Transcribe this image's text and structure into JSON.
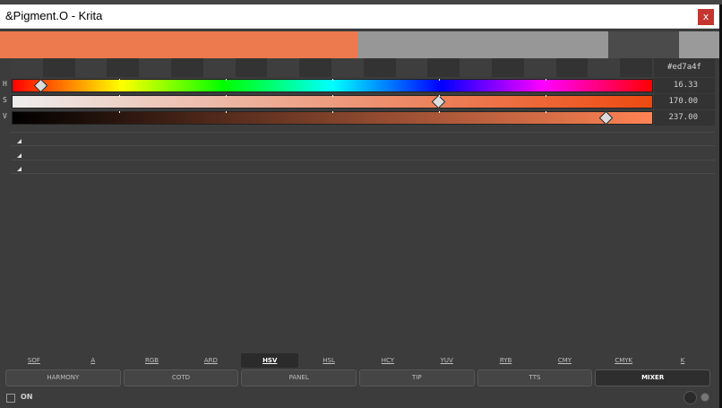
{
  "window": {
    "title": "&Pigment.O - Krita",
    "close_label": "x"
  },
  "swatches": [
    {
      "name": "current",
      "color": "#ed7a4f"
    },
    {
      "name": "previous",
      "color": "#979797"
    },
    {
      "name": "foreground",
      "color": "#4b4b4b"
    },
    {
      "name": "background",
      "color": "#9a9a9a"
    }
  ],
  "hex_value": "#ed7a4f",
  "sliders": [
    {
      "label": "H",
      "value": "16.33",
      "fraction": 0.045
    },
    {
      "label": "S",
      "value": "170.00",
      "fraction": 0.667
    },
    {
      "label": "V",
      "value": "237.00",
      "fraction": 0.929
    }
  ],
  "modes": [
    {
      "label": "SOF",
      "active": false
    },
    {
      "label": "A",
      "active": false
    },
    {
      "label": "RGB",
      "active": false
    },
    {
      "label": "ARD",
      "active": false
    },
    {
      "label": "HSV",
      "active": true
    },
    {
      "label": "HSL",
      "active": false
    },
    {
      "label": "HCY",
      "active": false
    },
    {
      "label": "YUV",
      "active": false
    },
    {
      "label": "RYB",
      "active": false
    },
    {
      "label": "CMY",
      "active": false
    },
    {
      "label": "CMYK",
      "active": false
    },
    {
      "label": "K",
      "active": false
    }
  ],
  "panels": [
    {
      "label": "HARMONY",
      "active": false
    },
    {
      "label": "COTD",
      "active": false
    },
    {
      "label": "PANEL",
      "active": false
    },
    {
      "label": "TIP",
      "active": false
    },
    {
      "label": "TTS",
      "active": false
    },
    {
      "label": "MIXER",
      "active": true
    }
  ],
  "status": {
    "on_label": "ON"
  }
}
